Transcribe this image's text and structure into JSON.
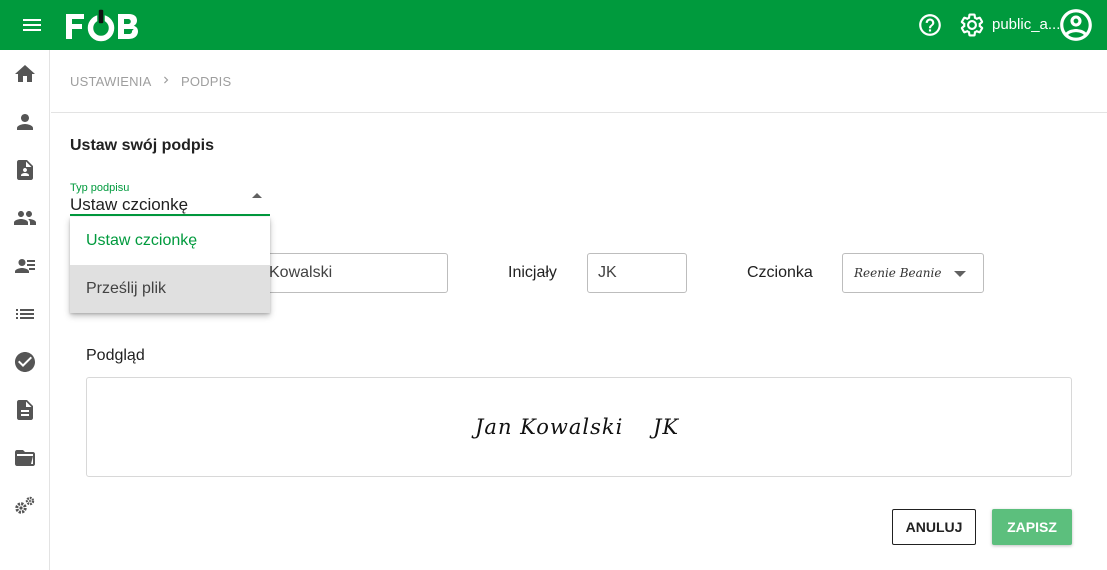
{
  "app": {
    "logo_text": "FOB",
    "username": "public_a...",
    "accent_color": "#009a3d"
  },
  "breadcrumb": {
    "items": [
      "USTAWIENIA",
      "PODPIS"
    ]
  },
  "page": {
    "title": "Ustaw swój podpis"
  },
  "signature_type": {
    "label": "Typ podpisu",
    "value": "Ustaw czcionkę",
    "options": [
      "Ustaw czcionkę",
      "Prześlij plik"
    ]
  },
  "form": {
    "name_value": "Kowalski",
    "initials_label": "Inicjały",
    "initials_value": "JK",
    "font_label": "Czcionka",
    "font_value": "Reenie Beanie"
  },
  "preview": {
    "label": "Podgląd",
    "name_text": "Jan Kowalski",
    "initials_text": "JK"
  },
  "actions": {
    "cancel_label": "ANULUJ",
    "save_label": "ZAPISZ"
  },
  "sidebar": {
    "icons": [
      "home-icon",
      "person-icon",
      "document-person-icon",
      "people-icon",
      "person-list-icon",
      "list-icon",
      "check-circle-icon",
      "document-icon",
      "folder-open-icon",
      "settings-cogs-icon"
    ]
  }
}
